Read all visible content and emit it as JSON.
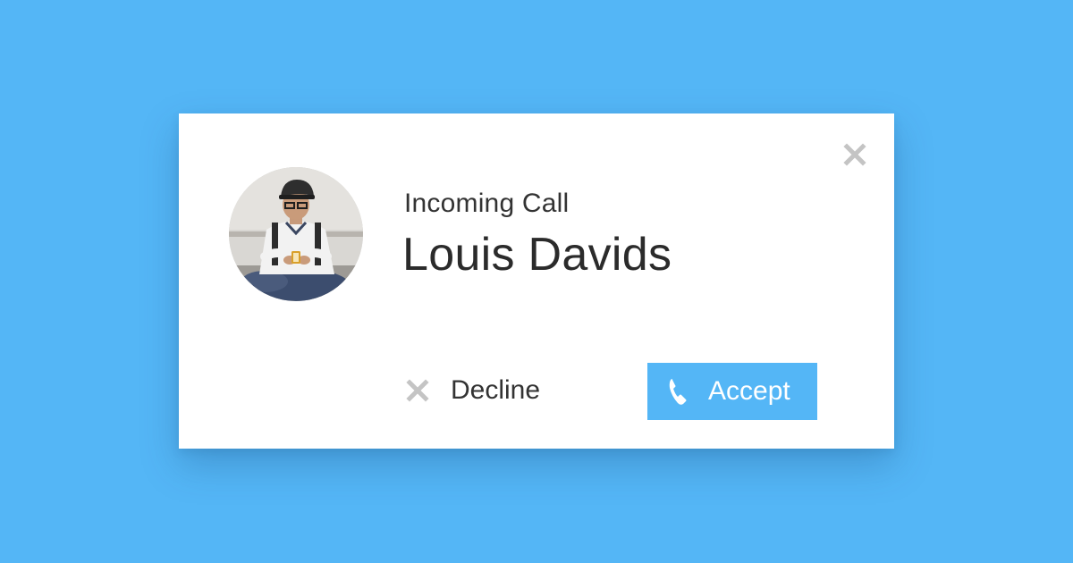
{
  "colors": {
    "background": "#54b6f6",
    "accent": "#54b6f6",
    "dialog": "#ffffff",
    "icon_gray": "#c4c4c4",
    "text": "#333333"
  },
  "dialog": {
    "close_icon": "close-icon",
    "avatar_icon": "caller-photo",
    "call_label": "Incoming Call",
    "caller_name": "Louis Davids",
    "actions": {
      "decline": {
        "label": "Decline",
        "icon": "close-icon"
      },
      "accept": {
        "label": "Accept",
        "icon": "phone-icon"
      }
    }
  }
}
